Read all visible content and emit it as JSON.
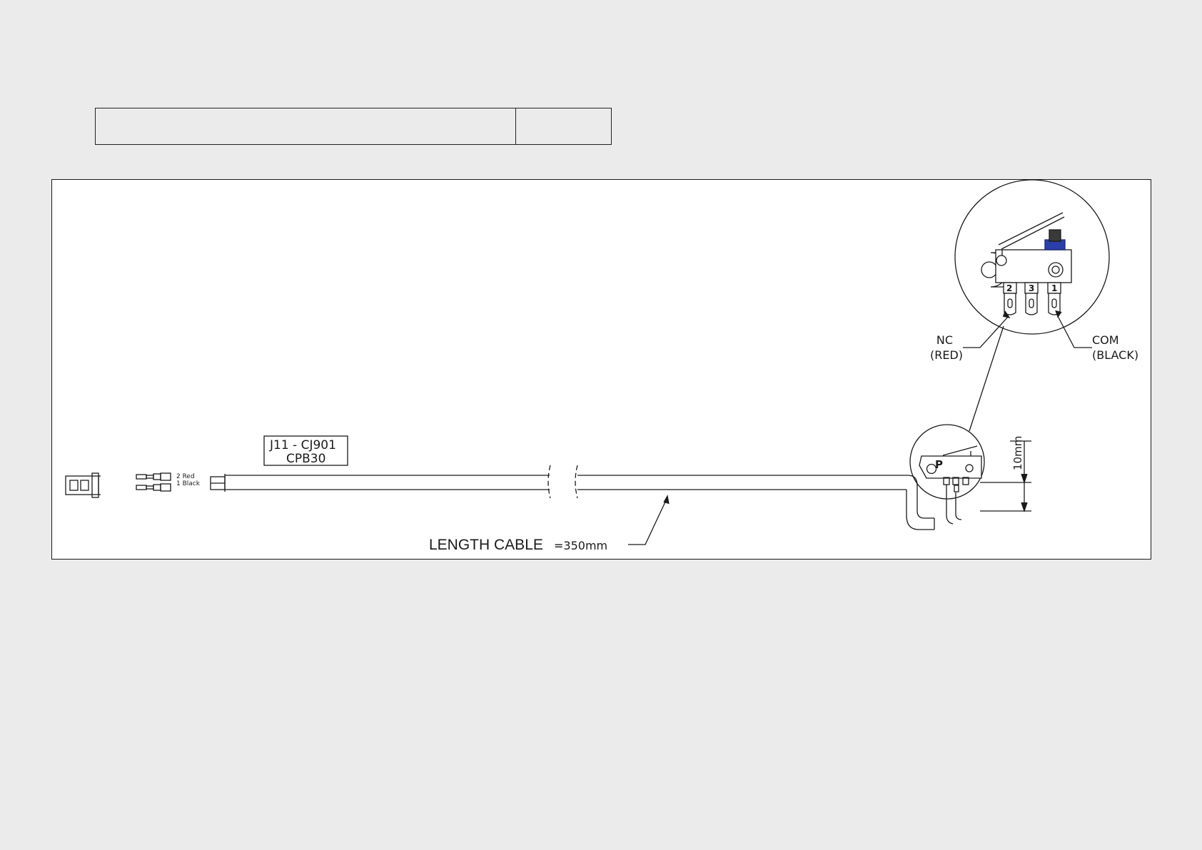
{
  "connector_label": {
    "line1": "J11 - CJ901",
    "line2": "CPB30"
  },
  "wire_labels": {
    "red": "2 Red",
    "black": "1 Black"
  },
  "cable_length": {
    "prefix": "LENGTH CABLE",
    "value": "=350mm"
  },
  "dimension": "10mm",
  "pins": {
    "left": "2",
    "middle": "3",
    "right": "1"
  },
  "callouts": {
    "nc": "NC",
    "nc_color": "(RED)",
    "com": "COM",
    "com_color": "(BLACK)"
  },
  "small_switch_mark": "P",
  "colors": {
    "line": "#1a1a1a",
    "actuator": "#2b3fa8",
    "page_bg": "#ebebeb",
    "sheet_bg": "#ffffff"
  }
}
